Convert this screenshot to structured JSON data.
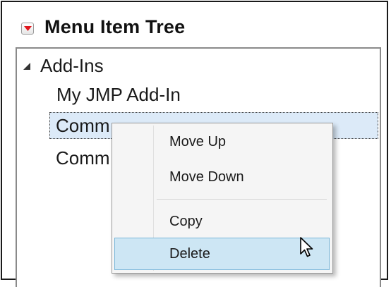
{
  "panel": {
    "title": "Menu Item Tree"
  },
  "tree": {
    "root": {
      "label": "Add-Ins",
      "expanded": true
    },
    "children": [
      {
        "label": "My JMP Add-In",
        "selected": false
      },
      {
        "label": "Comm",
        "selected": true
      },
      {
        "label": "Comm",
        "selected": false
      }
    ]
  },
  "context_menu": {
    "items": [
      {
        "label": "Move Up",
        "highlighted": false
      },
      {
        "label": "Move Down",
        "highlighted": false
      },
      {
        "label": "Copy",
        "highlighted": false
      },
      {
        "label": "Delete",
        "highlighted": true
      }
    ]
  },
  "icons": {
    "disclosure": "red-triangle-menu-icon",
    "tree_toggle": "expanded-triangle-icon",
    "cursor": "mouse-pointer-icon"
  },
  "colors": {
    "disclosure_triangle": "#e0171d",
    "selection_fill": "#dceaf8",
    "menu_highlight": "#cde6f4",
    "menu_highlight_border": "#79b6d9"
  }
}
